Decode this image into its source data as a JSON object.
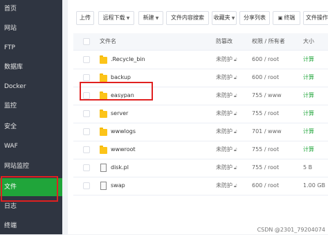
{
  "sidebar": {
    "items": [
      {
        "label": "首页"
      },
      {
        "label": "网站"
      },
      {
        "label": "FTP"
      },
      {
        "label": "数据库"
      },
      {
        "label": "Docker"
      },
      {
        "label": "监控"
      },
      {
        "label": "安全"
      },
      {
        "label": "WAF"
      },
      {
        "label": "网站监控"
      },
      {
        "label": "文件",
        "active": true
      },
      {
        "label": "日志"
      },
      {
        "label": "终端"
      }
    ]
  },
  "toolbar": {
    "upload": "上传",
    "remote_download": "远程下载",
    "new": "新建",
    "search_content": "文件内容搜索",
    "favorites": "收藏夹",
    "share_list": "分享列表",
    "terminal": "终端",
    "file_op": "文件操作"
  },
  "table": {
    "headers": {
      "name": "文件名",
      "protect": "防篡改",
      "perm": "权限 / 所有者",
      "size": "大小"
    },
    "rows": [
      {
        "name": ".Recycle_bin",
        "type": "folder",
        "protect": "未防护",
        "perm": "600 / root",
        "size": "计算"
      },
      {
        "name": "backup",
        "type": "folder",
        "protect": "未防护",
        "perm": "600 / root",
        "size": "计算"
      },
      {
        "name": "easypan",
        "type": "folder",
        "protect": "未防护",
        "perm": "755 / www",
        "size": "计算"
      },
      {
        "name": "server",
        "type": "folder",
        "protect": "未防护",
        "perm": "755 / root",
        "size": "计算"
      },
      {
        "name": "wwwlogs",
        "type": "folder",
        "protect": "未防护",
        "perm": "701 / www",
        "size": "计算"
      },
      {
        "name": "wwwroot",
        "type": "folder",
        "protect": "未防护",
        "perm": "755 / root",
        "size": "计算"
      },
      {
        "name": "disk.pl",
        "type": "file",
        "protect": "未防护",
        "perm": "755 / root",
        "size": "5 B"
      },
      {
        "name": "swap",
        "type": "file",
        "protect": "未防护",
        "perm": "600 / root",
        "size": "1.00 GB"
      }
    ]
  },
  "watermark": "CSDN @2301_79204074",
  "colors": {
    "sidebar_bg": "#2f3541",
    "accent_green": "#20a53a",
    "annotation_red": "#e02020",
    "folder": "#fcc419"
  }
}
